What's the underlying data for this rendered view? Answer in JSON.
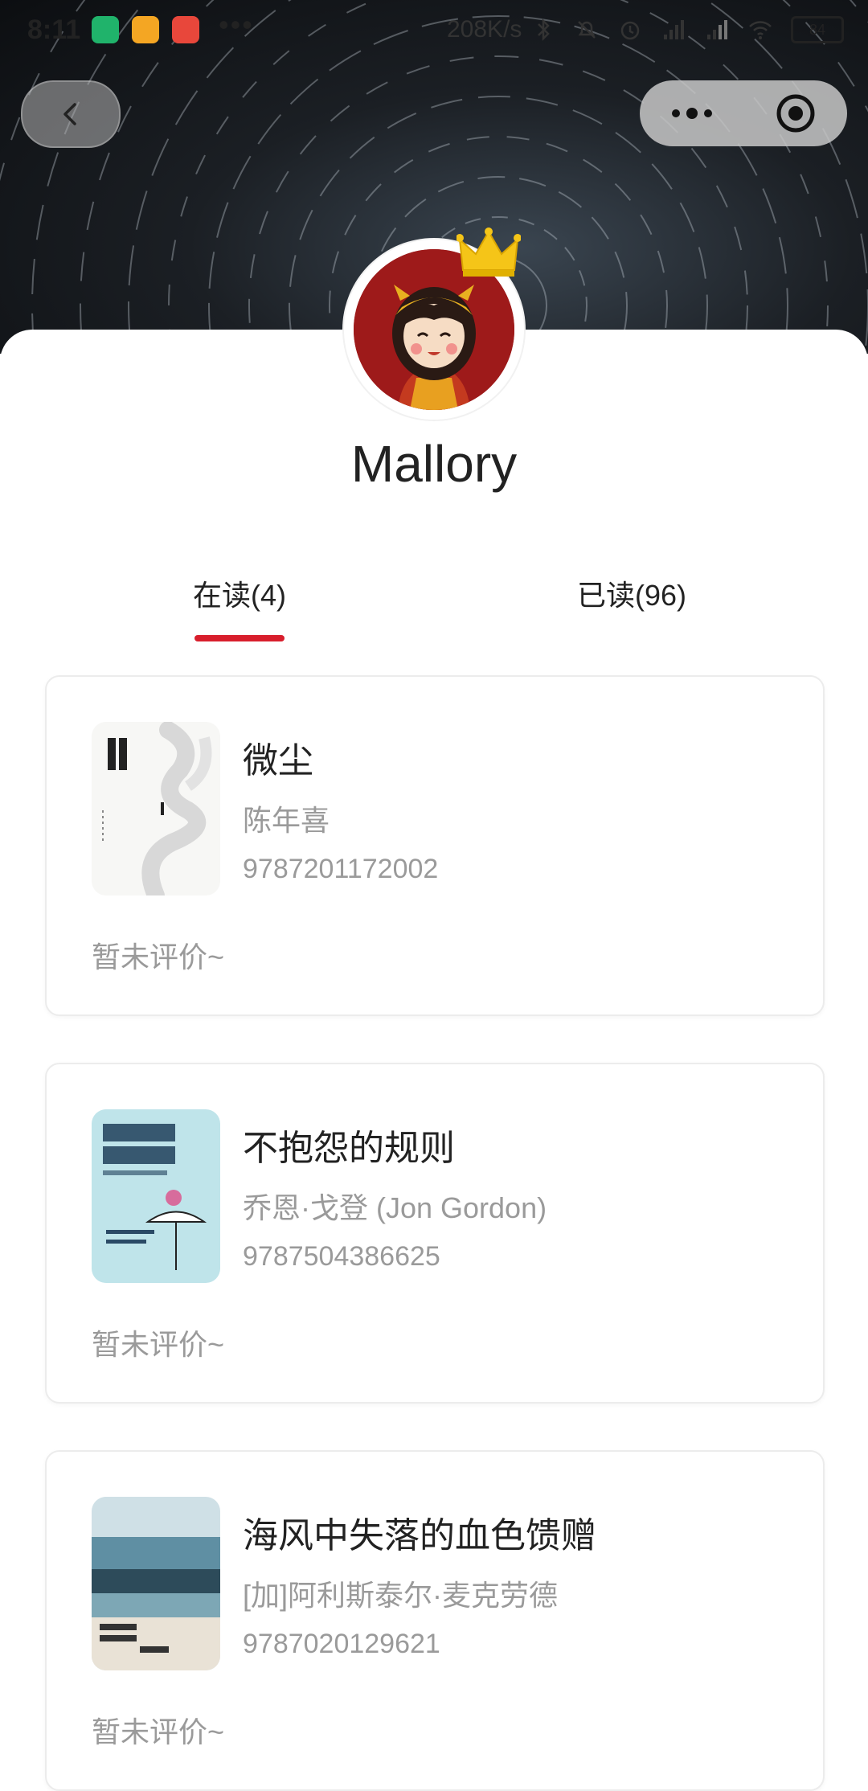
{
  "status_bar": {
    "time": "8:11",
    "more_dots": "•••",
    "network_speed": "208K/s",
    "battery": "84"
  },
  "header": {
    "back_icon": "chevron-left-icon",
    "menu_icon": "more-dots-icon",
    "close_icon": "target-circle-icon"
  },
  "profile": {
    "username": "Mallory",
    "avatar_icon": "cartoon-girl-avatar",
    "badge_icon": "crown-icon"
  },
  "tabs": [
    {
      "label": "在读(4)",
      "active": true
    },
    {
      "label": "已读(96)",
      "active": false
    }
  ],
  "books": [
    {
      "title": "微尘",
      "author": "陈年喜",
      "isbn": "9787201172002",
      "review": "暂未评价~"
    },
    {
      "title": "不抱怨的规则",
      "author": "乔恩·戈登 (Jon Gordon)",
      "isbn": "9787504386625",
      "review": "暂未评价~"
    },
    {
      "title": "海风中失落的血色馈赠",
      "author": "[加]阿利斯泰尔·麦克劳德",
      "isbn": "9787020129621",
      "review": "暂未评价~"
    }
  ],
  "colors": {
    "accent": "#d81e2c",
    "muted_text": "#9a9a9a"
  }
}
